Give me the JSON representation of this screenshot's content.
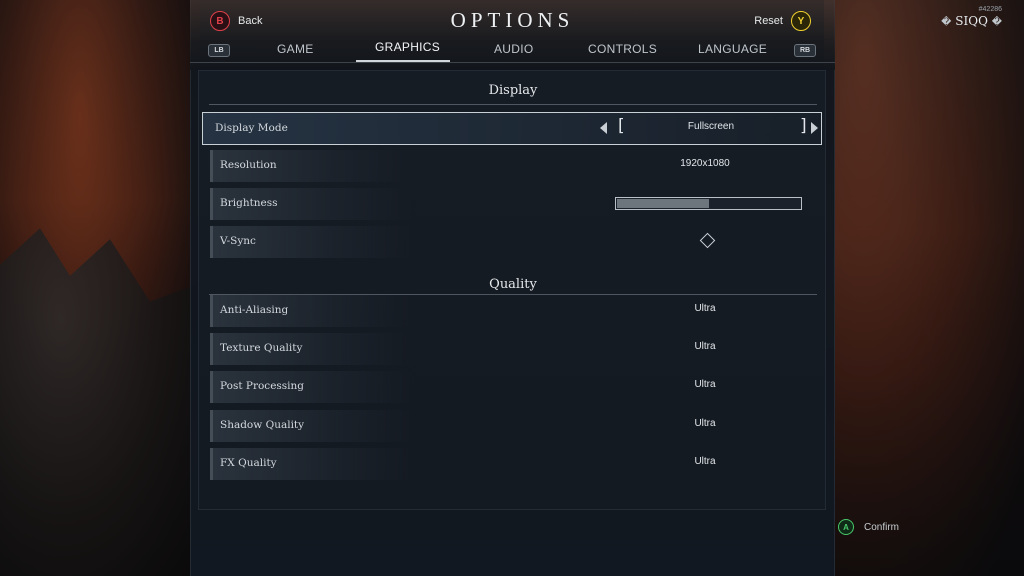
{
  "header": {
    "title": "OPTIONS",
    "back_button": {
      "key": "B",
      "label": "Back"
    },
    "reset_button": {
      "key": "Y",
      "label": "Reset"
    }
  },
  "tabs": {
    "left_bumper": "LB",
    "right_bumper": "RB",
    "items": [
      {
        "label": "GAME"
      },
      {
        "label": "GRAPHICS",
        "active": true
      },
      {
        "label": "AUDIO"
      },
      {
        "label": "CONTROLS"
      },
      {
        "label": "LANGUAGE"
      }
    ]
  },
  "user": {
    "id": "#42286",
    "name": "SIQQ",
    "left_glyph": "�",
    "right_glyph": "�"
  },
  "display_section": {
    "title": "Display",
    "display_mode": {
      "label": "Display Mode",
      "value": "Fullscreen",
      "left_bracket": "[",
      "right_bracket": "]"
    },
    "resolution": {
      "label": "Resolution",
      "value": "1920x1080"
    },
    "brightness": {
      "label": "Brightness",
      "level": 0.5
    },
    "vsync": {
      "label": "V-Sync",
      "checked": false
    }
  },
  "quality_section": {
    "title": "Quality",
    "rows": [
      {
        "label": "Anti-Aliasing",
        "value": "Ultra"
      },
      {
        "label": "Texture Quality",
        "value": "Ultra"
      },
      {
        "label": "Post Processing",
        "value": "Ultra"
      },
      {
        "label": "Shadow Quality",
        "value": "Ultra"
      },
      {
        "label": "FX Quality",
        "value": "Ultra"
      }
    ]
  },
  "footer": {
    "confirm_button": {
      "key": "A",
      "label": "Confirm"
    }
  },
  "colors": {
    "b_button": "#e0404a",
    "y_button": "#f0d030",
    "a_button": "#49c86a",
    "panel_bg": "#121821"
  }
}
